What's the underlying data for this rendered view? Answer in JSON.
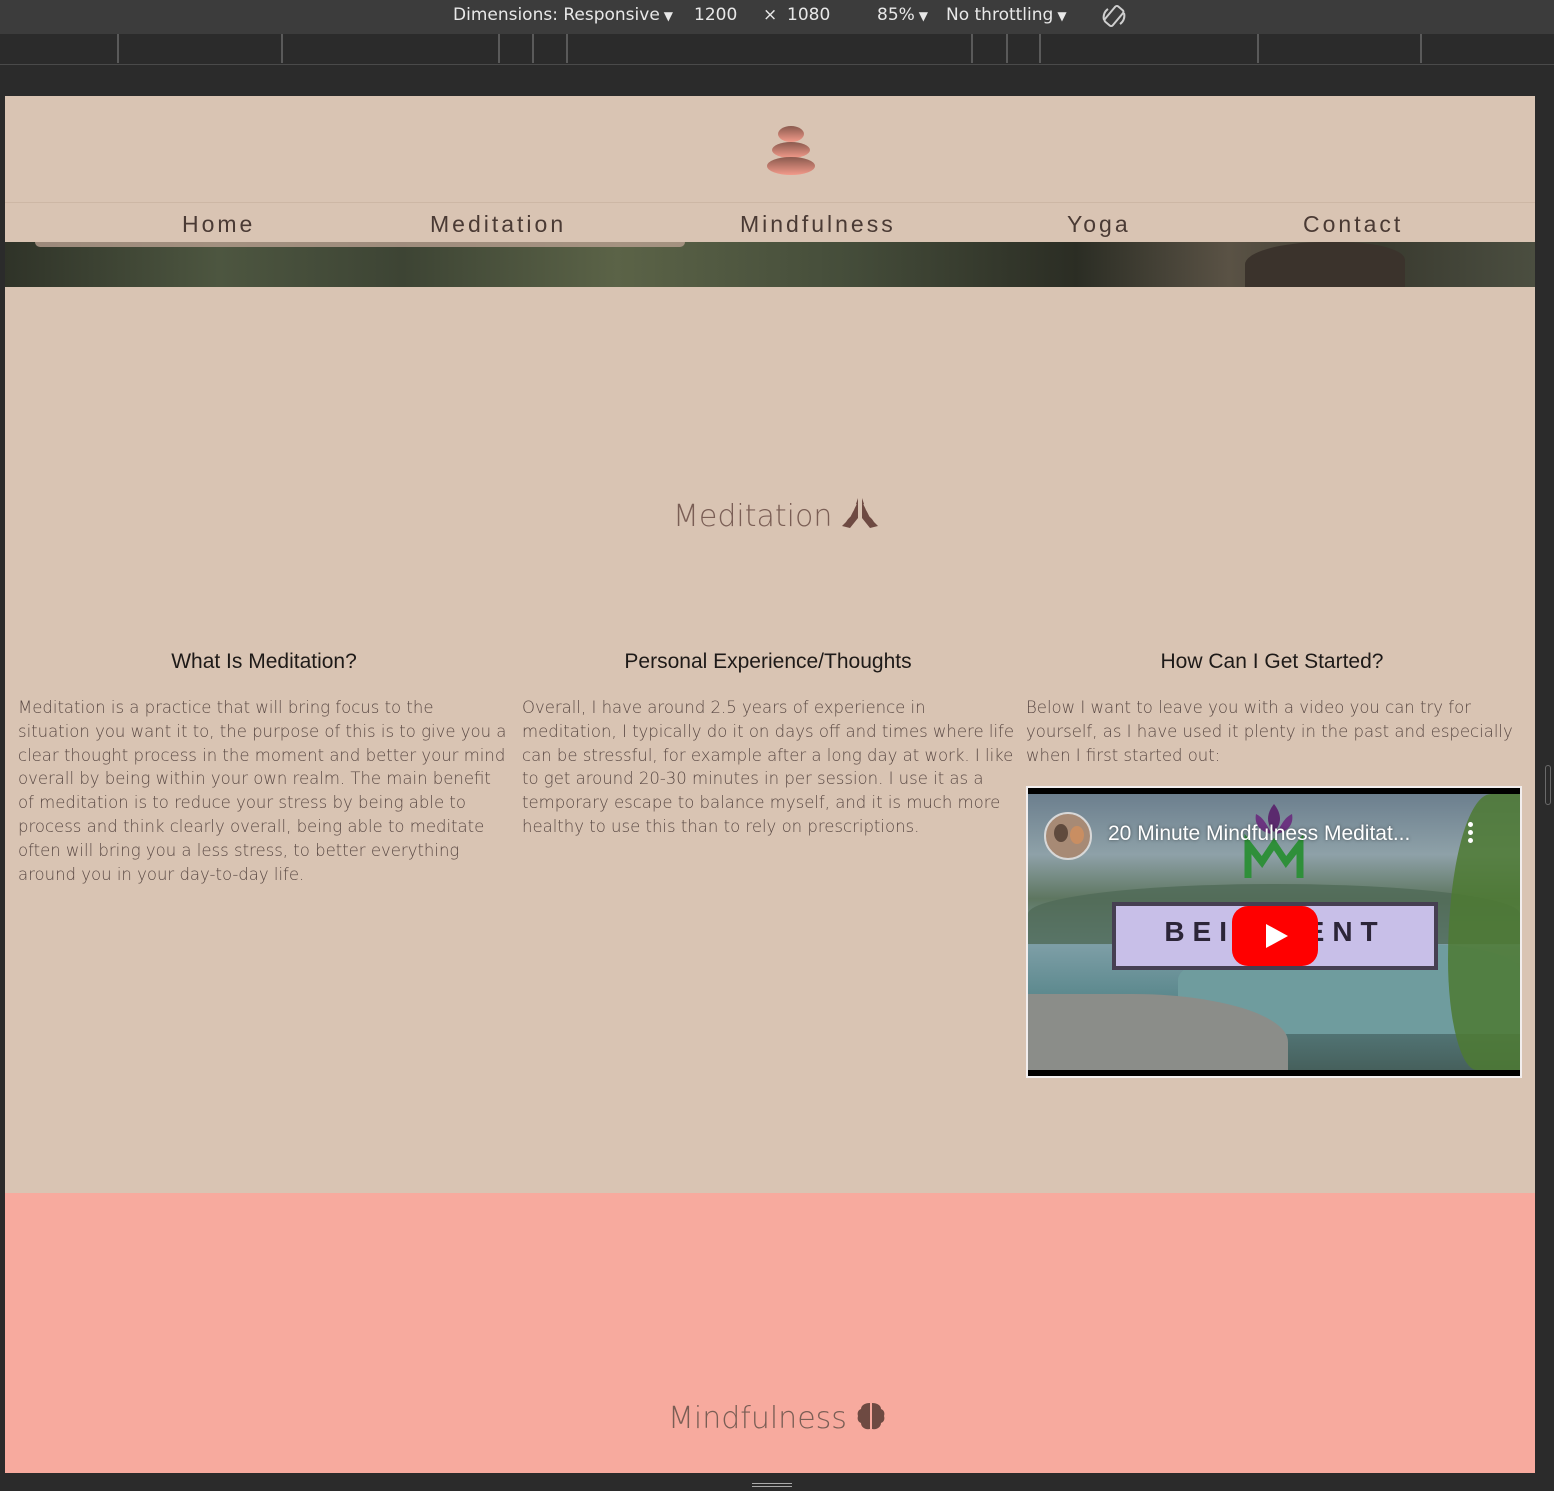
{
  "devtools": {
    "dimensions_label": "Dimensions: Responsive",
    "width": "1200",
    "times": "×",
    "height": "1080",
    "zoom": "85%",
    "throttling": "No throttling",
    "rotate_icon": "rotate-icon"
  },
  "site": {
    "logo_icon": "stacked-stones-icon",
    "nav": [
      "Home",
      "Meditation",
      "Mindfulness",
      "Yoga",
      "Contact"
    ]
  },
  "meditation": {
    "title": "Meditation",
    "icon": "praying-hands-icon",
    "columns": [
      {
        "heading": "What Is Meditation?",
        "text": "Meditation is a practice that will bring focus to the situation you want it to, the purpose of this is to give you a clear thought process in the moment and better your mind overall by being within your own realm. The main benefit of meditation is to reduce your stress by being able to process and think clearly overall, being able to meditate often will bring you a less stress, to better everything around you in your day-to-day life."
      },
      {
        "heading": "Personal Experience/Thoughts",
        "text": "Overall, I have around 2.5 years of experience in meditation, I typically do it on days off and times where life can be stressful, for example after a long day at work. I like to get around 20-30 minutes in per session. I use it as a temporary escape to balance myself, and it is much more healthy to use this than to rely on prescriptions."
      },
      {
        "heading": "How Can I Get Started?",
        "text": "Below I want to leave you with a video you can try for yourself, as I have used it plenty in the past and especially when I first started out:"
      }
    ],
    "video": {
      "title": "20 Minute Mindfulness Meditat...",
      "banner_text": "BEIN SENT",
      "play_icon": "youtube-play-icon",
      "menu_icon": "kebab-menu-icon"
    }
  },
  "mindfulness": {
    "title": "Mindfulness",
    "icon": "brain-icon"
  },
  "colors": {
    "page_bg": "#d9c4b3",
    "mindfulness_bg": "#f7aa9e",
    "title_color": "#7a5e55",
    "youtube_red": "#ff0000"
  }
}
